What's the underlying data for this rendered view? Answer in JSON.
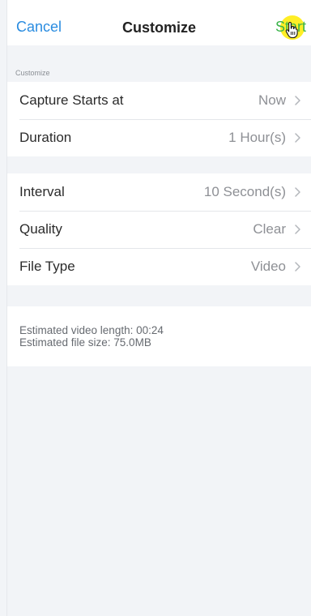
{
  "nav": {
    "cancel": "Cancel",
    "title": "Customize",
    "start": "Start"
  },
  "section_label": "Customize",
  "group1": [
    {
      "label": "Capture Starts at",
      "value": "Now"
    },
    {
      "label": "Duration",
      "value": "1 Hour(s)"
    }
  ],
  "group2": [
    {
      "label": "Interval",
      "value": "10 Second(s)"
    },
    {
      "label": "Quality",
      "value": "Clear"
    },
    {
      "label": "File Type",
      "value": "Video"
    }
  ],
  "info": {
    "video_length": "Estimated video length: 00:24",
    "file_size": "Estimated file size: 75.0MB"
  },
  "colors": {
    "accent_blue": "#2a8ce0",
    "start_green": "#3bb44a",
    "highlight_yellow": "#ffeb00",
    "background": "#f2f4f7"
  },
  "icons": [
    "chevron-right-icon",
    "hand-pointer-cursor-icon"
  ]
}
